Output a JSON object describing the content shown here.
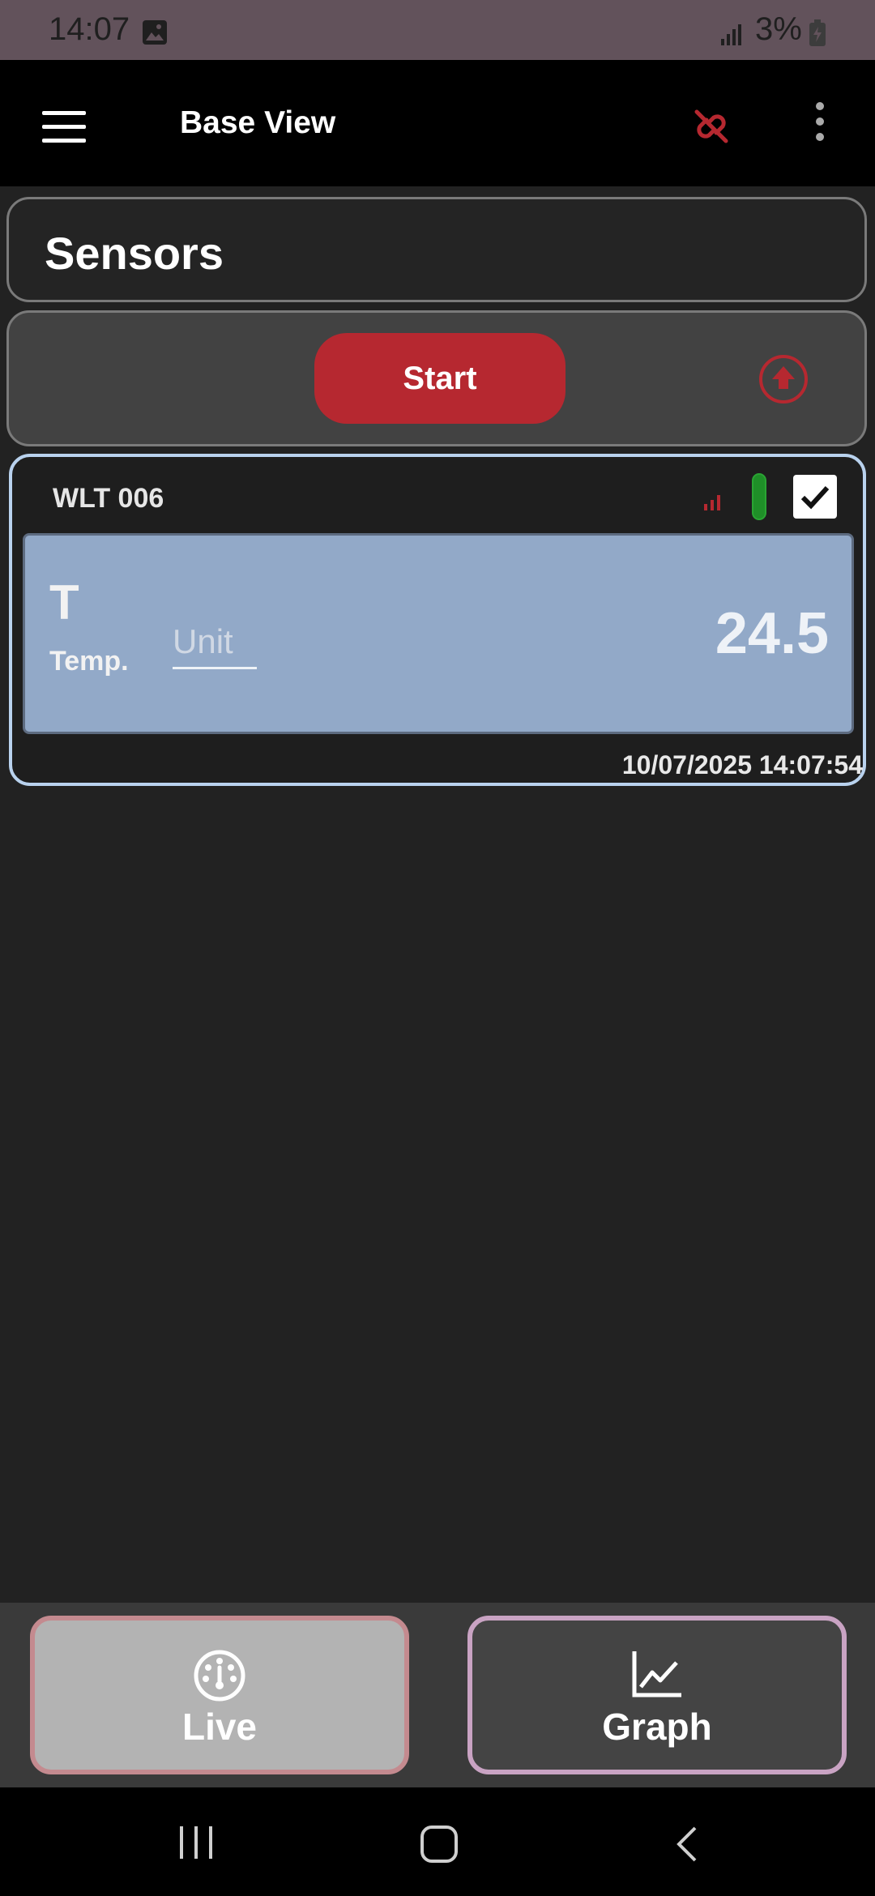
{
  "status_bar": {
    "time": "14:07",
    "battery_percent": "3%"
  },
  "app_bar": {
    "title": "Base View"
  },
  "sensors_panel": {
    "title": "Sensors"
  },
  "controls": {
    "start_label": "Start"
  },
  "sensor": {
    "name": "WLT 006",
    "checked": true,
    "reading": {
      "symbol": "T",
      "quantity": "Temp.",
      "unit_placeholder": "Unit",
      "value": "24.5"
    },
    "timestamp": "10/07/2025 14:07:54"
  },
  "bottom_nav": {
    "live_label": "Live",
    "graph_label": "Graph"
  },
  "colors": {
    "accent_red": "#b62830",
    "reading_panel": "#92a9c8",
    "card_border": "#b9d2ee",
    "battery_green": "#1f8f28"
  },
  "icons": [
    "image-icon",
    "signal-icon",
    "battery-icon",
    "menu-icon",
    "link-off-icon",
    "more-vert-icon",
    "upload-icon",
    "signal-strength-icon",
    "check-icon",
    "gauge-icon",
    "chart-line-icon",
    "recents-icon",
    "home-icon",
    "back-icon"
  ]
}
